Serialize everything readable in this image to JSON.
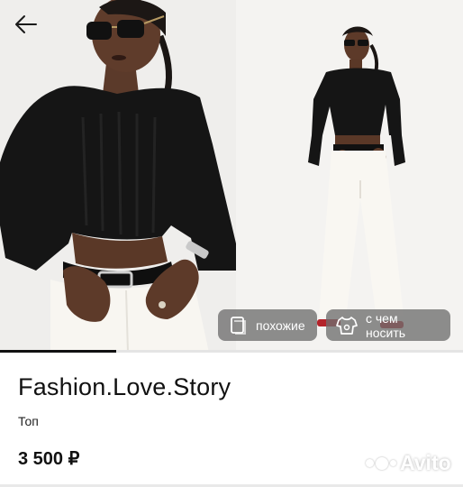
{
  "gallery": {
    "back_icon": "arrow-left-icon",
    "photo_count": 2,
    "progress": 0.25,
    "similar_label": "похожие",
    "similar_icon": "similar-cards-icon",
    "wear_label": "с чем носить",
    "wear_icon": "outfit-icon"
  },
  "product": {
    "title": "Fashion.Love.Story",
    "category": "Топ",
    "price": "3 500 ₽"
  },
  "watermark": {
    "label": "Avito"
  }
}
